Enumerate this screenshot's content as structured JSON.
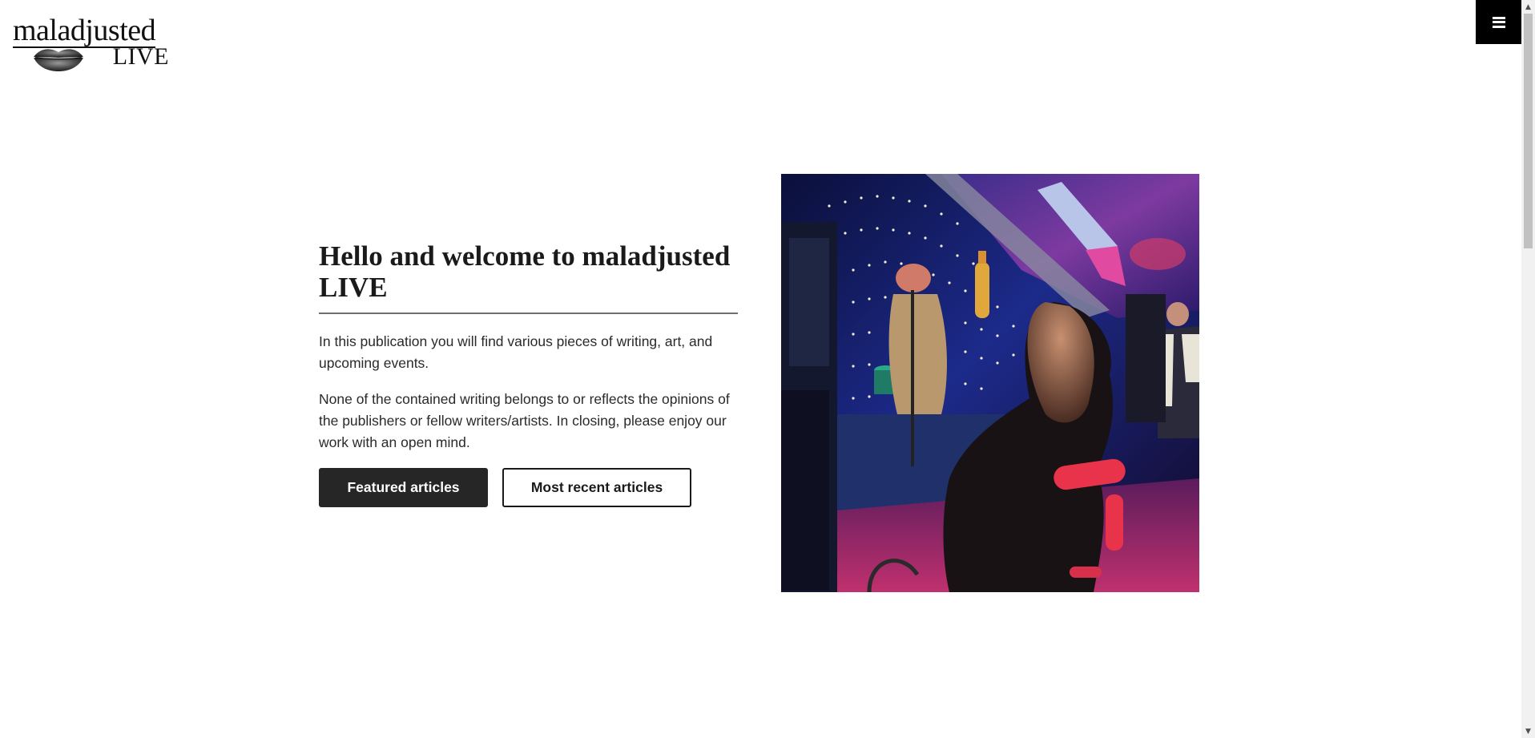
{
  "header": {
    "logo_text": "maladjusted",
    "logo_subtext": "LIVE",
    "menu_icon": "hamburger-menu-icon"
  },
  "hero": {
    "title": "Hello and welcome to maladjusted LIVE",
    "paragraph_1": "In this publication you will find various pieces of writing, art, and upcoming events.",
    "paragraph_2": "None of the contained writing belongs to or reflects the opinions of the publishers or fellow writers/artists. In closing, please enjoy our work with an open mind.",
    "primary_button_label": "Featured articles",
    "secondary_button_label": "Most recent articles"
  },
  "colors": {
    "text": "#1a1a1a",
    "primary_button_bg": "#262626",
    "menu_bg": "#000000",
    "page_bg": "#ffffff"
  }
}
